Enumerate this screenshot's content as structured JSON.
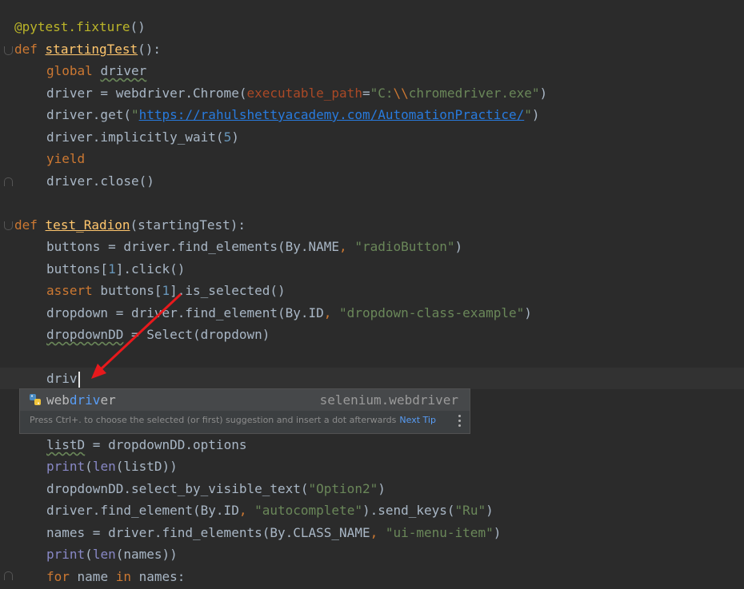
{
  "code": {
    "l1": {
      "decorator": "@pytest.fixture",
      "rest": "()"
    },
    "l2": {
      "kw": "def",
      "name": "startingTest",
      "rest": "():"
    },
    "l3": {
      "kw": "global",
      "name": "driver"
    },
    "l4": {
      "a": "driver = webdriver.Chrome(",
      "param": "executable_path",
      "eq": "=",
      "str1": "\"C:",
      "esc": "\\\\",
      "str2": "chromedriver.exe\"",
      "end": ")"
    },
    "l5": {
      "a": "driver.get(",
      "q1": "\"",
      "url": "https://rahulshettyacademy.com/AutomationPractice/",
      "q2": "\"",
      "end": ")"
    },
    "l6": {
      "a": "driver.implicitly_wait(",
      "num": "5",
      "end": ")"
    },
    "l7": {
      "kw": "yield"
    },
    "l8": {
      "a": "driver.close()"
    },
    "l9": {
      "kw": "def",
      "name": "test_Radion",
      "rest": "(startingTest):"
    },
    "l10": {
      "a": "buttons = driver.find_elements(By.NAME",
      "comma": ", ",
      "str": "\"radioButton\"",
      "end": ")"
    },
    "l11": {
      "a": "buttons[",
      "num": "1",
      "end": "].click()"
    },
    "l12": {
      "kw": "assert",
      "a": " buttons[",
      "num": "1",
      "end": "].is_selected()"
    },
    "l13": {
      "a": "dropdown = driver.find_element(By.ID",
      "comma": ", ",
      "str": "\"dropdown-class-example\"",
      "end": ")"
    },
    "l14": {
      "var": "dropdownDD",
      "rest": " = Select(dropdown)"
    },
    "l15": {
      "typed": "driv"
    },
    "l16": {
      "var": "listD",
      "rest": " = dropdownDD.options"
    },
    "l17": {
      "fn": "print",
      "a": "(",
      "fn2": "len",
      "end": "(listD))"
    },
    "l18": {
      "a": "dropdownDD.select_by_visible_text(",
      "str": "\"Option2\"",
      "end": ")"
    },
    "l19": {
      "a": "driver.find_element(By.ID",
      "comma": ", ",
      "str": "\"autocomplete\"",
      "mid": ").send_keys(",
      "str2": "\"Ru\"",
      "end": ")"
    },
    "l20": {
      "a": "names = driver.find_elements(By.CLASS_NAME",
      "comma": ", ",
      "str": "\"ui-menu-item\"",
      "end": ")"
    },
    "l21": {
      "fn": "print",
      "a": "(",
      "fn2": "len",
      "end": "(names))"
    },
    "l22": {
      "kw": "for",
      "a": " name ",
      "kw2": "in",
      "end": " names:"
    }
  },
  "autocomplete": {
    "item_prefix": "web",
    "item_match": "driv",
    "item_suffix": "er",
    "item_location": "selenium.webdriver",
    "hint": "Press Ctrl+. to choose the selected (or first) suggestion and insert a dot afterwards",
    "next_tip": "Next Tip",
    "icon": "python-package-icon"
  },
  "colors": {
    "background": "#2b2b2b",
    "keyword": "#cc7832",
    "string": "#6a8759",
    "number": "#6897bb",
    "function_def": "#ffc66d",
    "annotation_arrow": "#e8191c"
  }
}
